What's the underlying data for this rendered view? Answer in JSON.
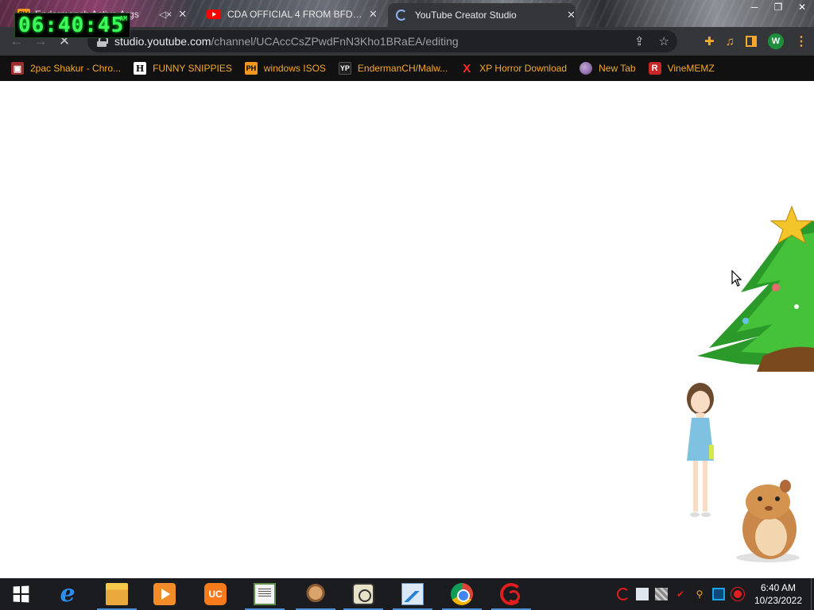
{
  "browser": {
    "tabs": [
      {
        "title": "Endermanch Active Args",
        "muted": true
      },
      {
        "title": "CDA OFFICIAL 4 FROM BFDI!!!!!!"
      },
      {
        "title": "YouTube Creator Studio",
        "active": true,
        "loading": true
      }
    ],
    "url_host": "studio.youtube.com",
    "url_path": "/channel/UCAccCsZPwdFnN3Kho1BRaEA/editing",
    "profile_initial": "W",
    "bookmarks": [
      {
        "label": "2pac Shakur - Chro...",
        "icon": "2pac-icon"
      },
      {
        "label": "FUNNY SNIPPIES",
        "icon_text": "H"
      },
      {
        "label": "windows ISOS",
        "icon_text": "PH"
      },
      {
        "label": "EndermanCH/Malw...",
        "icon_text": "YP"
      },
      {
        "label": "XP Horror Download",
        "icon_text": "X"
      },
      {
        "label": "New Tab",
        "icon": "globe-icon"
      },
      {
        "label": "VineMEMZ",
        "icon_text": "R"
      }
    ],
    "colors": {
      "accent": "#f6a92a",
      "toolbar": "#35363a",
      "bookmark_bar": "#111111"
    }
  },
  "desktop_clock": {
    "time": "06:40:45",
    "suffix": "AM"
  },
  "taskbar": {
    "apps": [
      {
        "name": "internet-explorer-icon",
        "glyph": "e"
      },
      {
        "name": "file-explorer-icon"
      },
      {
        "name": "media-player-icon"
      },
      {
        "name": "uc-browser-icon",
        "glyph": "UC"
      },
      {
        "name": "document-viewer-icon"
      },
      {
        "name": "hamster-app-icon"
      },
      {
        "name": "stopwatch-app-icon"
      },
      {
        "name": "resource-monitor-icon"
      },
      {
        "name": "chrome-icon"
      },
      {
        "name": "red-spiral-app-icon"
      }
    ],
    "time": "6:40 AM",
    "date": "10/23/2022"
  }
}
